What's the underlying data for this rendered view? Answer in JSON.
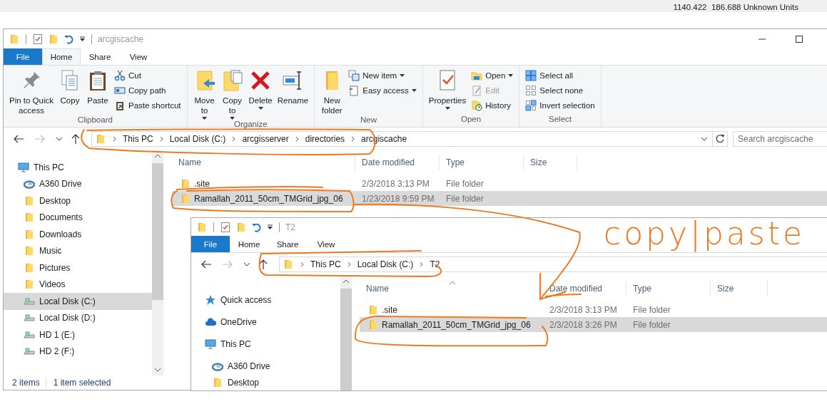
{
  "top_bar": {
    "readout": "1140.422  186.688 Unknown Units"
  },
  "main_window": {
    "title": "arcgiscache",
    "tabs": [
      {
        "label": "File",
        "kind": "file",
        "selected": false
      },
      {
        "label": "Home",
        "kind": "tab",
        "selected": true
      },
      {
        "label": "Share",
        "kind": "tab",
        "selected": false
      },
      {
        "label": "View",
        "kind": "tab",
        "selected": false
      }
    ],
    "ribbon": [
      {
        "label": "Clipboard",
        "buttons": [
          {
            "kind": "large",
            "label": "Pin to Quick\naccess",
            "dropdown": false,
            "disabled": false
          },
          {
            "kind": "large",
            "label": "Copy",
            "dropdown": false,
            "disabled": false
          },
          {
            "kind": "large",
            "label": "Paste",
            "dropdown": false,
            "disabled": false
          },
          {
            "kind": "small",
            "label": "Cut",
            "dropdown": false,
            "disabled": false
          },
          {
            "kind": "small",
            "label": "Copy path",
            "dropdown": false,
            "disabled": false
          },
          {
            "kind": "small",
            "label": "Paste shortcut",
            "dropdown": false,
            "disabled": false
          }
        ]
      },
      {
        "label": "Organize",
        "buttons": [
          {
            "kind": "large",
            "label": "Move\nto",
            "dropdown": true,
            "disabled": false
          },
          {
            "kind": "large",
            "label": "Copy\nto",
            "dropdown": true,
            "disabled": false
          },
          {
            "kind": "large",
            "label": "Delete",
            "dropdown": true,
            "disabled": false
          },
          {
            "kind": "large",
            "label": "Rename",
            "dropdown": false,
            "disabled": false
          }
        ]
      },
      {
        "label": "New",
        "buttons": [
          {
            "kind": "large",
            "label": "New\nfolder",
            "dropdown": false,
            "disabled": false
          },
          {
            "kind": "small",
            "label": "New item",
            "dropdown": true,
            "disabled": false
          },
          {
            "kind": "small",
            "label": "Easy access",
            "dropdown": true,
            "disabled": false
          }
        ]
      },
      {
        "label": "Open",
        "buttons": [
          {
            "kind": "large",
            "label": "Properties",
            "dropdown": true,
            "disabled": false
          },
          {
            "kind": "small",
            "label": "Open",
            "dropdown": true,
            "disabled": false
          },
          {
            "kind": "small",
            "label": "Edit",
            "dropdown": false,
            "disabled": true
          },
          {
            "kind": "small",
            "label": "History",
            "dropdown": false,
            "disabled": false
          }
        ]
      },
      {
        "label": "Select",
        "buttons": [
          {
            "kind": "small",
            "label": "Select all",
            "dropdown": false,
            "disabled": false
          },
          {
            "kind": "small",
            "label": "Select none",
            "dropdown": false,
            "disabled": false
          },
          {
            "kind": "small",
            "label": "Invert selection",
            "dropdown": false,
            "disabled": false
          }
        ]
      }
    ],
    "path": [
      "This PC",
      "Local Disk (C:)",
      "arcgisserver",
      "directories",
      "arcgiscache"
    ],
    "search": {
      "placeholder": "Search arcgiscache"
    },
    "nav": [
      {
        "label": "This PC",
        "kind": "pc",
        "selected": false,
        "children": [
          {
            "label": "A360 Drive",
            "kind": "a360",
            "selected": false
          },
          {
            "label": "Desktop",
            "kind": "folder",
            "selected": false
          },
          {
            "label": "Documents",
            "kind": "folder",
            "selected": false
          },
          {
            "label": "Downloads",
            "kind": "folder",
            "selected": false
          },
          {
            "label": "Music",
            "kind": "folder",
            "selected": false
          },
          {
            "label": "Pictures",
            "kind": "folder",
            "selected": false
          },
          {
            "label": "Videos",
            "kind": "folder",
            "selected": false
          },
          {
            "label": "Local Disk (C:)",
            "kind": "drive",
            "selected": true
          },
          {
            "label": "Local Disk (D:)",
            "kind": "drive",
            "selected": false
          },
          {
            "label": "HD 1 (E:)",
            "kind": "drive",
            "selected": false
          },
          {
            "label": "HD 2 (F:)",
            "kind": "drive",
            "selected": false
          }
        ]
      }
    ],
    "columns": [
      {
        "label": "Name",
        "sorted": false
      },
      {
        "label": "Date modified",
        "sorted": false
      },
      {
        "label": "Type",
        "sorted": false
      },
      {
        "label": "Size",
        "sorted": false
      }
    ],
    "rows": [
      {
        "cells": [
          ".site",
          "2/3/2018 3:13 PM",
          "File folder"
        ],
        "selected": false
      },
      {
        "cells": [
          "Ramallah_2011_50cm_TMGrid_jpg_06",
          "1/23/2018 9:59 PM",
          "File folder"
        ],
        "selected": true
      }
    ],
    "status": {
      "item_count": "2 items",
      "selection": "1 item selected"
    }
  },
  "second_window": {
    "title": "T2",
    "tabs": [
      {
        "label": "File",
        "kind": "file",
        "selected": false
      },
      {
        "label": "Home",
        "kind": "tab",
        "selected": false
      },
      {
        "label": "Share",
        "kind": "tab",
        "selected": false
      },
      {
        "label": "View",
        "kind": "tab",
        "selected": false
      }
    ],
    "path": [
      "This PC",
      "Local Disk (C:)",
      "T2"
    ],
    "nav": [
      {
        "label": "Quick access",
        "kind": "star",
        "selected": false
      },
      {
        "label": "OneDrive",
        "kind": "cloud",
        "selected": false
      },
      {
        "label": "This PC",
        "kind": "pc",
        "selected": false,
        "children": [
          {
            "label": "A360 Drive",
            "kind": "a360",
            "selected": false
          },
          {
            "label": "Desktop",
            "kind": "folder",
            "selected": false
          }
        ]
      }
    ],
    "columns": [
      {
        "label": "Name",
        "sorted": true
      },
      {
        "label": "Date modified",
        "sorted": false
      },
      {
        "label": "Type",
        "sorted": false
      },
      {
        "label": "Size",
        "sorted": false
      }
    ],
    "rows": [
      {
        "cells": [
          ".site",
          "2/3/2018 3:13 PM",
          "File folder"
        ],
        "selected": false
      },
      {
        "cells": [
          "Ramallah_2011_50cm_TMGrid_jpg_06",
          "2/3/2018 3:26 PM",
          "File folder"
        ],
        "selected": true
      }
    ]
  },
  "annotation": {
    "note": "copy|paste"
  }
}
